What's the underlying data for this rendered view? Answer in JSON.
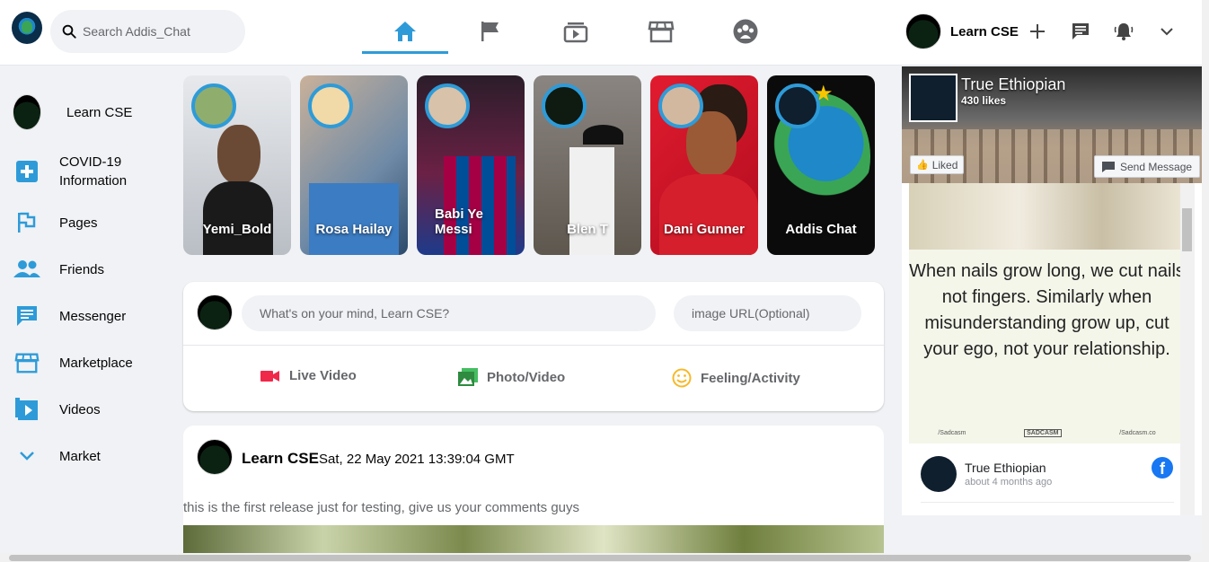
{
  "header": {
    "search_placeholder": "Search Addis_Chat",
    "nav": [
      "home-icon",
      "flag-icon",
      "video-icon",
      "store-icon",
      "groups-icon"
    ],
    "user_name": "Learn CSE"
  },
  "sidebar": {
    "items": [
      {
        "label": "Learn CSE",
        "icon": "avatar"
      },
      {
        "label": "COVID-19 Information",
        "icon": "plus-icon"
      },
      {
        "label": "Pages",
        "icon": "flag-icon"
      },
      {
        "label": "Friends",
        "icon": "people-icon"
      },
      {
        "label": "Messenger",
        "icon": "chat-icon"
      },
      {
        "label": "Marketplace",
        "icon": "store-icon"
      },
      {
        "label": "Videos",
        "icon": "video-icon"
      },
      {
        "label": "Market",
        "icon": "chevron-down-icon"
      }
    ]
  },
  "stories": [
    {
      "name": "Yemi_Bold",
      "bg": "#d7dbe0"
    },
    {
      "name": "Rosa Hailay",
      "bg": "#8ea7bd"
    },
    {
      "name": "Babi Ye Messi",
      "bg": "#3b1f3e"
    },
    {
      "name": "Blen T",
      "bg": "#8a7f70"
    },
    {
      "name": "Dani Gunner",
      "bg": "#c8102e"
    },
    {
      "name": "Addis Chat",
      "bg": "#0b0b0b"
    }
  ],
  "composer": {
    "post_placeholder": "What's on your mind, Learn CSE?",
    "image_placeholder": "image URL(Optional)",
    "options": [
      "Live Video",
      "Photo/Video",
      "Feeling/Activity"
    ],
    "colors": {
      "live": "#f02849",
      "photo": "#45bd62",
      "feeling": "#f7b928"
    }
  },
  "post": {
    "author": "Learn CSE",
    "date": "Sat, 22 May 2021 13:39:04 GMT",
    "text": "this is the first release just for testing, give us your comments guys"
  },
  "page_widget": {
    "page_name": "True Ethiopian",
    "likes": "430 likes",
    "liked_label": "Liked",
    "send_label": "Send Message",
    "quote": "When nails grow long, we cut nails not fingers. Similarly when misunderstanding grow up, cut your ego, not your relationship.",
    "footer": [
      "/Sadcasm",
      "SADCASM",
      "/Sadcasm.co"
    ],
    "feed_name": "True Ethiopian",
    "feed_time": "about 4 months ago"
  },
  "accent": "#2e9bd8"
}
